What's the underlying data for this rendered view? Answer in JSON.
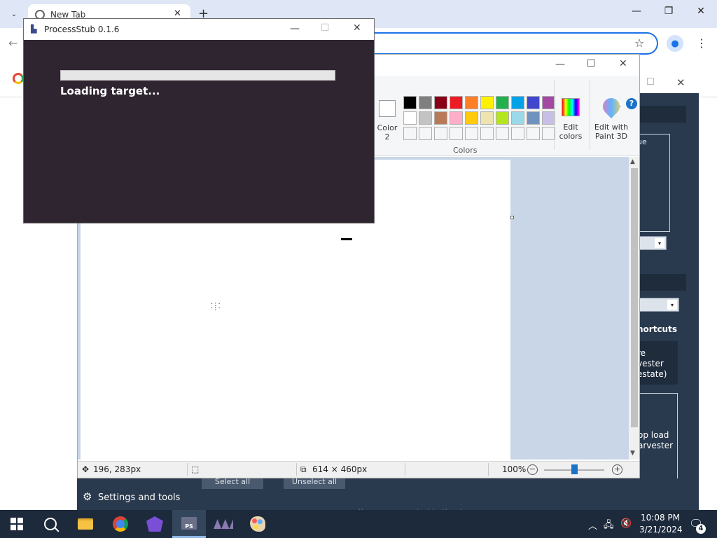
{
  "chrome": {
    "tab_title": "New Tab",
    "close_tab": "✕",
    "new_tab": "+",
    "minimize": "—",
    "restore": "❐",
    "close": "✕",
    "back": "←",
    "star": "☆",
    "menu": "⋮",
    "tab_search": "⌄"
  },
  "dark_app": {
    "box1_text": "ue",
    "shortcuts_label": "hortcuts",
    "box2_lines": [
      "re",
      "vester",
      "estate)"
    ],
    "box3_lines": [
      "op load",
      "arvester"
    ],
    "settings_label": "Settings and tools",
    "select_all": "Select all",
    "unselect_all": "Unselect all",
    "status_message": "You are connected to the dev server.",
    "dropdown_arrow": "▾"
  },
  "paint": {
    "minimize": "—",
    "maximize": "☐",
    "close": "✕",
    "help": "?",
    "collapse": "︿",
    "color2_label": "Color 2",
    "colors_label": "Colors",
    "edit_colors_label": "Edit colors",
    "paint3d_label": "Edit with Paint 3D",
    "palette_row1": [
      "#000000",
      "#7f7f7f",
      "#880015",
      "#ed1c24",
      "#ff7f27",
      "#fff200",
      "#22b14c",
      "#00a2e8",
      "#3f48cc",
      "#a349a4"
    ],
    "palette_row2": [
      "#ffffff",
      "#c3c3c3",
      "#b97a57",
      "#ffaec9",
      "#ffc90e",
      "#efe4b0",
      "#b5e61d",
      "#99d9ea",
      "#7092be",
      "#c8bfe7"
    ],
    "palette_row3": [
      "#f5f6f7",
      "#f5f6f7",
      "#f5f6f7",
      "#f5f6f7",
      "#f5f6f7",
      "#f5f6f7",
      "#f5f6f7",
      "#f5f6f7",
      "#f5f6f7",
      "#f5f6f7"
    ],
    "status": {
      "cursor_position": "196, 283px",
      "canvas_size": "614 × 460px",
      "zoom": "100%",
      "zoom_out": "−",
      "zoom_in": "+"
    }
  },
  "process_stub": {
    "title": "ProcessStub 0.1.6",
    "loading_text": "Loading target...",
    "progress_percent": 0,
    "minimize": "—",
    "maximize": "☐",
    "close": "✕"
  },
  "taskbar": {
    "time": "10:08 PM",
    "date": "3/21/2024",
    "notification_count": "4",
    "tray_chevron": "︿",
    "ps_label": "PS"
  }
}
